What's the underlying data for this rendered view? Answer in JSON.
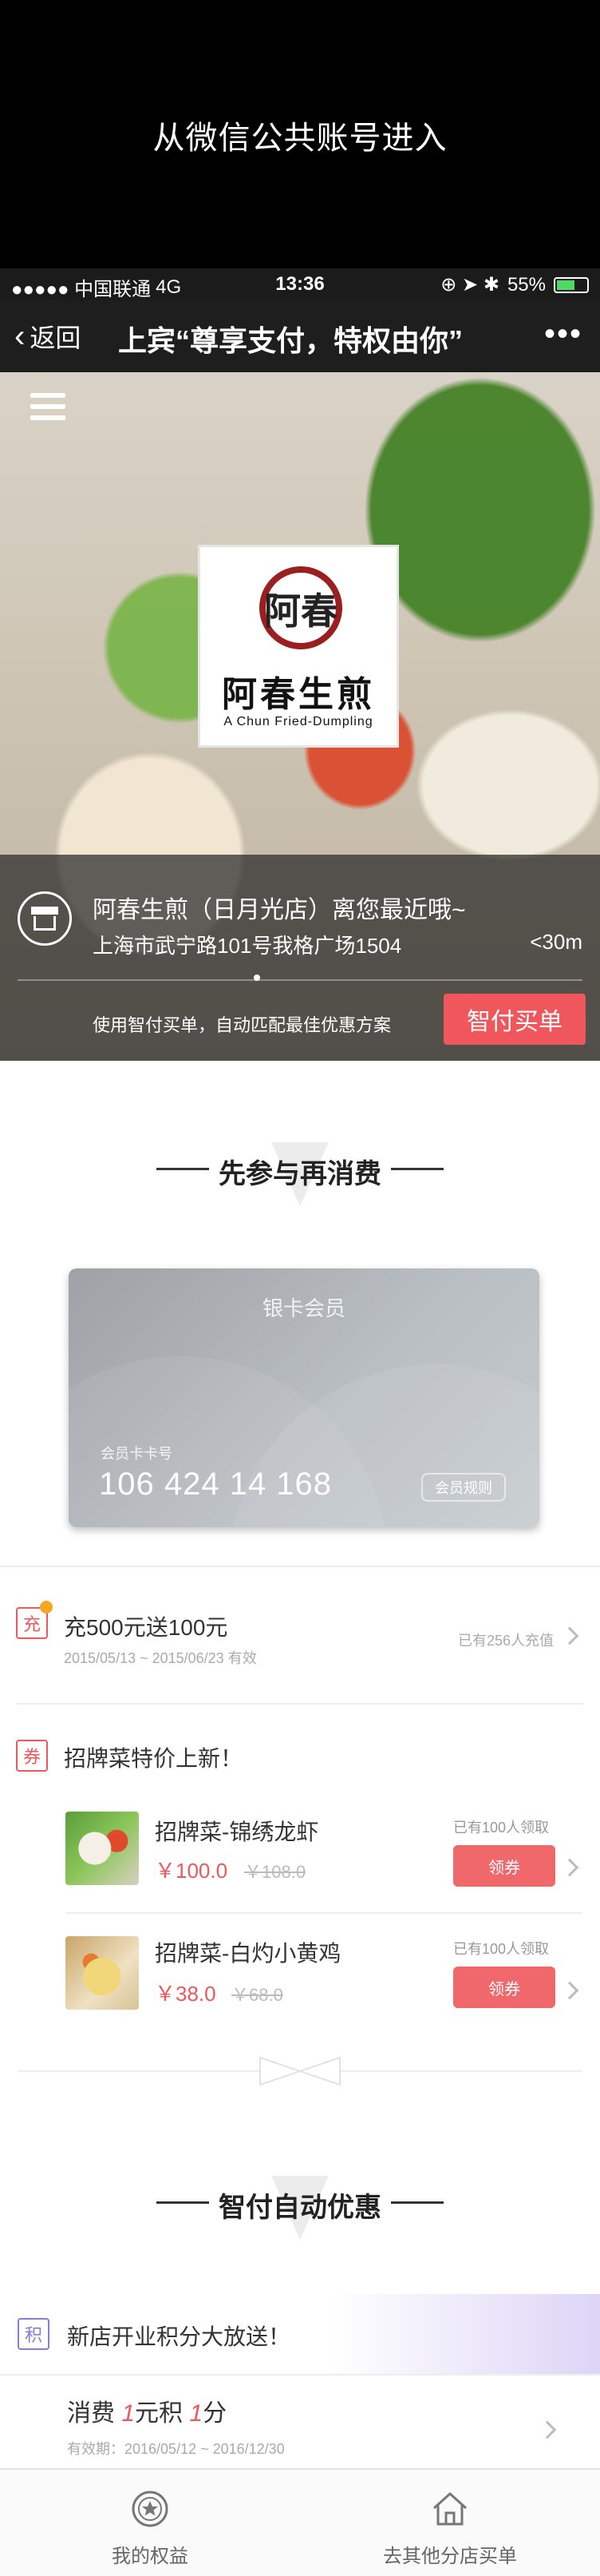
{
  "banner": {
    "caption": "从微信公共账号进入"
  },
  "status_bar": {
    "carrier": "●●●●● 中国联通",
    "network": "4G",
    "time": "13:36",
    "battery": "55%",
    "icons": "⊕ ➤ ✱"
  },
  "nav": {
    "back_label": "返回",
    "title": "上宾“尊享支付，特权由你”",
    "more": "•••"
  },
  "hero": {
    "logo_seal_text": "阿春",
    "logo_name": "阿春生煎",
    "logo_en": "A Chun Fried-Dumpling",
    "store_name": "阿春生煎（日月光店）离您最近哦~",
    "store_address": "上海市武宁路101号我格广场1504",
    "distance": "<30m",
    "pay_hint": "使用智付买单，自动匹配最佳优惠方案",
    "pay_button": "智付买单"
  },
  "section1": {
    "title": "先参与再消费"
  },
  "member_card": {
    "title": "银卡会员",
    "number_label": "会员卡卡号",
    "number": "106 424 14 168",
    "rules_button": "会员规则"
  },
  "recharge": {
    "badge": "充",
    "title": "充500元送100元",
    "dates": "2015/05/13 ~ 2015/06/23 有效",
    "participants": "已有256人充值"
  },
  "specials": {
    "badge": "券",
    "title": "招牌菜特价上新！",
    "items": [
      {
        "name": "招牌菜-锦绣龙虾",
        "price": "￥100.0",
        "old_price": "￥108.0",
        "claimed": "已有100人领取",
        "button": "领券"
      },
      {
        "name": "招牌菜-白灼小黄鸡",
        "price": "￥38.0",
        "old_price": "￥68.0",
        "claimed": "已有100人领取",
        "button": "领券"
      }
    ]
  },
  "section2": {
    "title": "智付自动优惠"
  },
  "points": {
    "badge": "积",
    "title": "新店开业积分大放送！",
    "rule_prefix": "消费 ",
    "rule_amount": "1",
    "rule_mid": "元积 ",
    "rule_points": "1",
    "rule_suffix": "分",
    "dates": "有效期：2016/05/12 ~ 2016/12/30"
  },
  "tabs": [
    {
      "label": "我的权益",
      "icon": "star-badge-icon"
    },
    {
      "label": "去其他分店买单",
      "icon": "home-icon"
    }
  ],
  "colors": {
    "accent": "#f0575c",
    "purple": "#8b7ccf",
    "bar": "#1e1e1e"
  }
}
